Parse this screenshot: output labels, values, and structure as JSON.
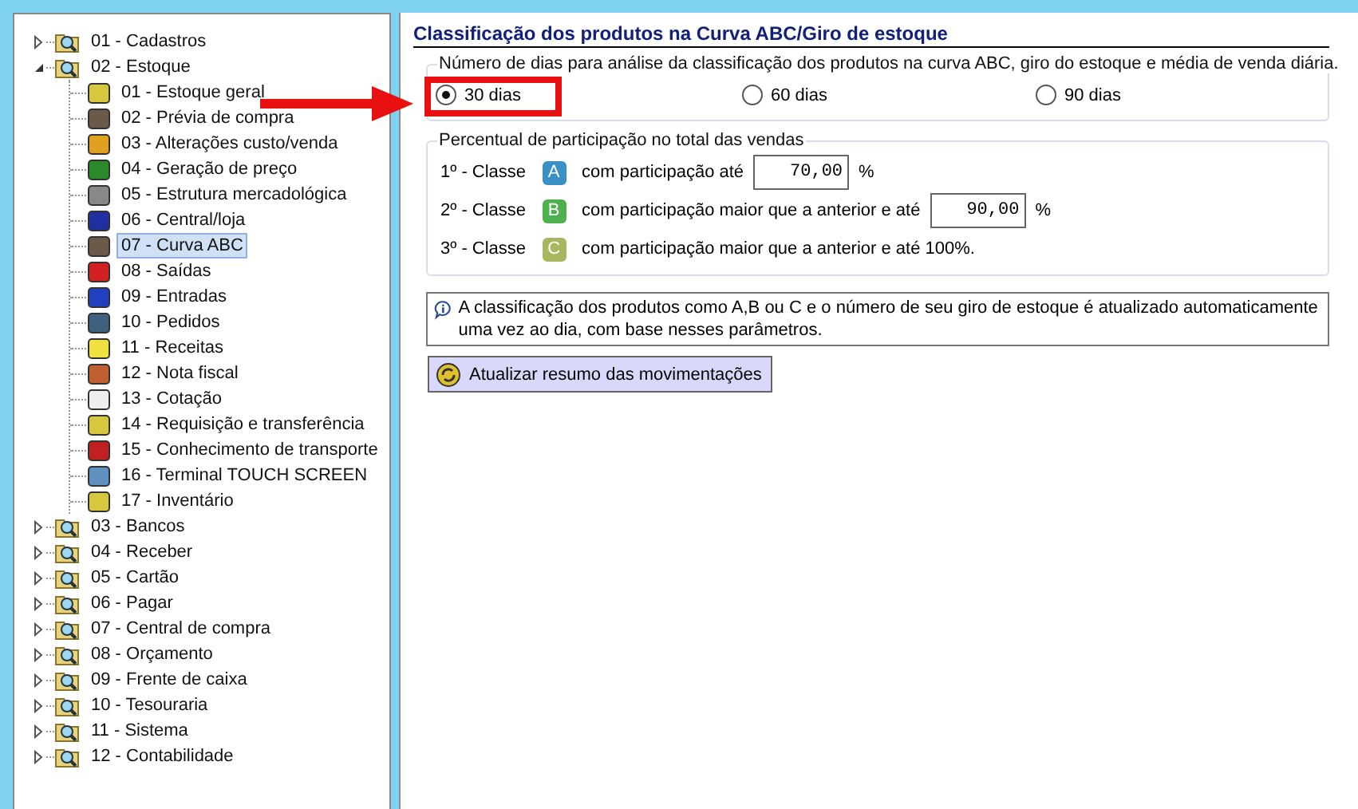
{
  "tree": [
    {
      "label": "01 - Cadastros",
      "expanded": false
    },
    {
      "label": "02 - Estoque",
      "expanded": true,
      "children": [
        {
          "label": "01 - Estoque geral",
          "selected": false
        },
        {
          "label": "02 - Prévia de compra",
          "selected": false
        },
        {
          "label": "03 - Alterações custo/venda",
          "selected": false
        },
        {
          "label": "04 - Geração de preço",
          "selected": false
        },
        {
          "label": "05 - Estrutura mercadológica",
          "selected": false
        },
        {
          "label": "06 - Central/loja",
          "selected": false
        },
        {
          "label": "07 - Curva ABC",
          "selected": true
        },
        {
          "label": "08 - Saídas",
          "selected": false
        },
        {
          "label": "09 - Entradas",
          "selected": false
        },
        {
          "label": "10 - Pedidos",
          "selected": false
        },
        {
          "label": "11 - Receitas",
          "selected": false
        },
        {
          "label": "12 - Nota fiscal",
          "selected": false
        },
        {
          "label": "13 - Cotação",
          "selected": false
        },
        {
          "label": "14 - Requisição e transferência",
          "selected": false
        },
        {
          "label": "15 - Conhecimento de transporte",
          "selected": false
        },
        {
          "label": "16 - Terminal TOUCH SCREEN",
          "selected": false
        },
        {
          "label": "17 - Inventário",
          "selected": false
        }
      ]
    },
    {
      "label": "03 - Bancos",
      "expanded": false
    },
    {
      "label": "04 - Receber",
      "expanded": false
    },
    {
      "label": "05 - Cartão",
      "expanded": false
    },
    {
      "label": "06 - Pagar",
      "expanded": false
    },
    {
      "label": "07 - Central de compra",
      "expanded": false
    },
    {
      "label": "08 - Orçamento",
      "expanded": false
    },
    {
      "label": "09 - Frente de caixa",
      "expanded": false
    },
    {
      "label": "10 - Tesouraria",
      "expanded": false
    },
    {
      "label": "11 - Sistema",
      "expanded": false
    },
    {
      "label": "12 - Contabilidade",
      "expanded": false
    }
  ],
  "panel": {
    "title": "Classificação dos produtos na Curva ABC/Giro de estoque",
    "days_group": {
      "legend": "Número de dias para análise da classificação dos produtos na curva ABC, giro do estoque e média de venda diária.",
      "options": [
        {
          "label": "30 dias",
          "selected": true
        },
        {
          "label": "60 dias",
          "selected": false
        },
        {
          "label": "90 dias",
          "selected": false
        }
      ]
    },
    "share_group": {
      "legend": "Percentual de participação no total das vendas",
      "classes": [
        {
          "prefix": "1º - Classe",
          "badge": "A",
          "color": "#3a8fc4",
          "text": "com participação até",
          "value": "70,00",
          "unit": "%"
        },
        {
          "prefix": "2º - Classe",
          "badge": "B",
          "color": "#4fb04f",
          "text": "com participação maior que a anterior e até",
          "value": "90,00",
          "unit": "%"
        },
        {
          "prefix": "3º - Classe",
          "badge": "C",
          "color": "#a8b860",
          "text": "com participação maior que a anterior e até 100%."
        }
      ]
    },
    "info": "A classificação dos produtos como A,B ou C e o número de seu giro de estoque é atualizado automaticamente uma vez ao dia, com base nesses parâmetros.",
    "button": "Atualizar resumo das movimentações"
  }
}
